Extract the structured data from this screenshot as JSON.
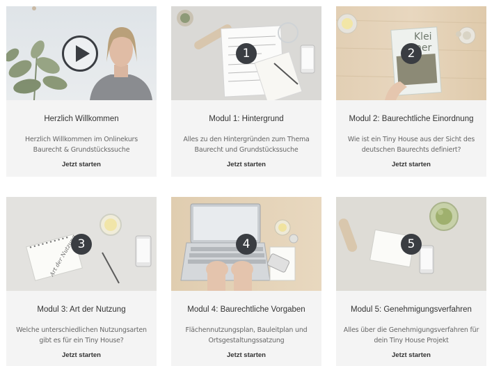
{
  "colors": {
    "card_bg": "#f4f4f4",
    "badge_bg": "#3a3d42",
    "badge_text": "#ffffff"
  },
  "modules": [
    {
      "badge": "",
      "icon": "play-icon",
      "title": "Herzlich Willkommen",
      "desc_line1": "Herzlich Willkommen im Onlinekurs",
      "desc_line2": "Baurecht & Grundstückssuche",
      "cta": "Jetzt starten"
    },
    {
      "badge": "1",
      "title": "Modul 1: Hintergrund",
      "desc_line1": "Alles zu den Hintergründen zum Thema",
      "desc_line2": "Baurecht und Grundstückssuche",
      "cta": "Jetzt starten"
    },
    {
      "badge": "2",
      "title": "Modul 2: Baurechtliche Einordnung",
      "desc_line1": "Wie ist ein Tiny House aus der Sicht des",
      "desc_line2": "deutschen Baurechts definiert?",
      "cta": "Jetzt starten"
    },
    {
      "badge": "3",
      "title": "Modul 3: Art der Nutzung",
      "desc_line1": "Welche unterschiedlichen Nutzungsarten",
      "desc_line2": "gibt es für ein Tiny House?",
      "cta": "Jetzt starten"
    },
    {
      "badge": "4",
      "title": "Modul 4: Baurechtliche Vorgaben",
      "desc_line1": "Flächennutzungsplan, Bauleitplan und",
      "desc_line2": "Ortsgestaltungssatzung",
      "cta": "Jetzt starten"
    },
    {
      "badge": "5",
      "title": "Modul 5: Genehmigungsverfahren",
      "desc_line1": "Alles über die Genehmigungsverfahren für",
      "desc_line2": "dein Tiny House Projekt",
      "cta": "Jetzt starten"
    }
  ],
  "thumb_text": {
    "book_title_1": "Klei",
    "book_title_2": "ner",
    "notebook_script": "Art der Nutzung"
  }
}
